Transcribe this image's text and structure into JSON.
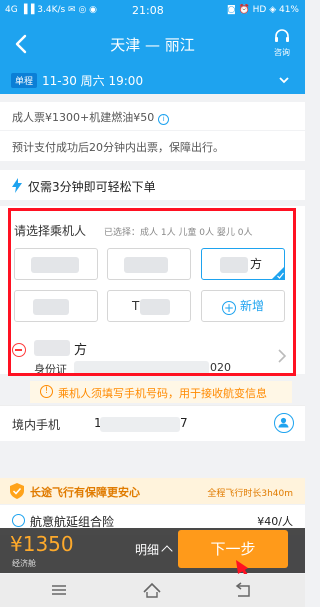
{
  "status_bar": {
    "left": "4G ▐▐ 3.4K/s ✉ ◎ ◉",
    "time": "21:08",
    "right": "◙ ⏰ HD ◈ 41%"
  },
  "header": {
    "title": "天津 — 丽江",
    "service_label": "咨询"
  },
  "trip": {
    "tag": "单程",
    "info": "11-30 周六 19:00"
  },
  "price": {
    "text": "成人票¥1300+机建燃油¥50"
  },
  "notice": {
    "text": "预计支付成功后20分钟内出票，保障出行。"
  },
  "promo": {
    "text": "仅需3分钟即可轻松下单"
  },
  "passengers": {
    "title": "请选择乘机人",
    "counts": "已选择：成人 1人 儿童 0人 婴儿 0人",
    "chips": [
      {
        "label": ""
      },
      {
        "label": ""
      },
      {
        "label": "方"
      },
      {
        "label": ""
      },
      {
        "label": "T"
      },
      {
        "label": "新增"
      }
    ],
    "selected": {
      "name": "方",
      "id_label": "身份证",
      "id_tail": "020"
    },
    "warning": "乘机人须填写手机号码，用于接收航变信息"
  },
  "phone": {
    "label": "境内手机",
    "prefix": "1",
    "suffix": "7"
  },
  "insurance": {
    "title": "长途飞行有保障更安心",
    "note": "全程飞行时长3h40m",
    "item_name": "航意航延组合险",
    "item_price": "¥40/人"
  },
  "bottom": {
    "total": "¥1350",
    "total_sub": "经济舱",
    "detail_label": "明细",
    "next_label": "下一步"
  },
  "colors": {
    "brand": "#1ea3ef",
    "accent_orange": "#ff9a1a",
    "highlight_red": "#ff1122"
  }
}
